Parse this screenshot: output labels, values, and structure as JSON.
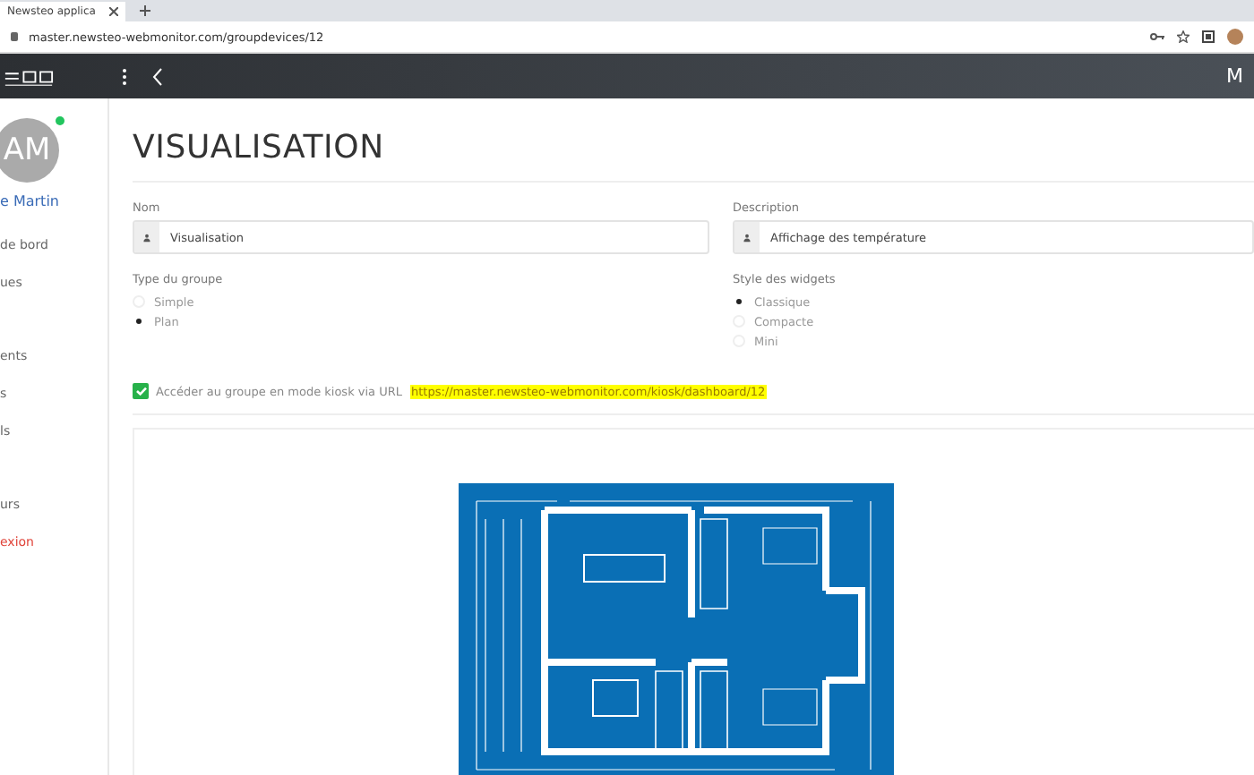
{
  "browser": {
    "tab_title": "Newsteo applica",
    "address": "master.newsteo-webmonitor.com/groupdevices/12"
  },
  "header": {
    "user_initial": "M"
  },
  "sidebar": {
    "avatar": "AM",
    "online": true,
    "user_name": "e Martin",
    "sections": [
      [
        {
          "label": "de bord",
          "kind": "normal"
        },
        {
          "label": "ues",
          "kind": "normal"
        }
      ],
      [
        {
          "label": "ents",
          "kind": "normal"
        },
        {
          "label": "s",
          "kind": "normal"
        },
        {
          "label": "ls",
          "kind": "normal"
        }
      ],
      [
        {
          "label": "urs",
          "kind": "normal"
        },
        {
          "label": "exion",
          "kind": "danger"
        }
      ]
    ]
  },
  "page_title": "VISUALISATION",
  "fields": [
    {
      "label": "Nom",
      "value": "Visualisation"
    },
    {
      "label": "Description",
      "value": "Affichage des température"
    }
  ],
  "radio_groups": [
    {
      "label": "Type du groupe",
      "options": [
        {
          "label": "Simple",
          "selected": false
        },
        {
          "label": "Plan",
          "selected": true
        }
      ]
    },
    {
      "label": "Style des widgets",
      "options": [
        {
          "label": "Classique",
          "selected": true
        },
        {
          "label": "Compacte",
          "selected": false
        },
        {
          "label": "Mini",
          "selected": false
        }
      ]
    }
  ],
  "kiosk": {
    "checked": true,
    "label": "Accéder au groupe en mode kiosk via URL",
    "url": "https://master.newsteo-webmonitor.com/kiosk/dashboard/12"
  }
}
